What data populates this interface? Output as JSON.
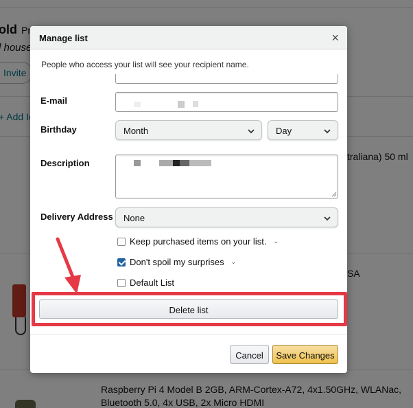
{
  "background": {
    "list_name_fragment": "old",
    "list_name_suffix": "Pr",
    "subtitle_fragment": "l househ",
    "invite_label": "Invite",
    "add_idea_label": "+ Add Id",
    "item1_fragment": "traliana) 50 ml",
    "item2_fragment": "SA",
    "item3_title": "Raspberry Pi 4 Model B 2GB, ARM-Cortex-A72, 4x1.50GHz, WLANac, Bluetooth 5.0, 4x USB, 2x Micro HDMI"
  },
  "modal": {
    "title": "Manage list",
    "close_glyph": "×",
    "notice": "People who access your list will see your recipient name.",
    "email_label": "E-mail",
    "birthday_label": "Birthday",
    "birthday_month": "Month",
    "birthday_day": "Day",
    "description_label": "Description",
    "delivery_label": "Delivery Address",
    "delivery_value": "None",
    "checkboxes": [
      {
        "label": "Keep purchased items on your list.",
        "checked": false
      },
      {
        "label": "Don't spoil my surprises",
        "checked": true
      },
      {
        "label": "Default List",
        "checked": false
      }
    ],
    "delete_label": "Delete list",
    "cancel_label": "Cancel",
    "save_label": "Save Changes"
  },
  "annotation": {
    "color": "#e63946"
  },
  "icons": {
    "close": "close-icon",
    "chevron": "chevron-down-icon",
    "arrow": "annotation-arrow-icon"
  }
}
